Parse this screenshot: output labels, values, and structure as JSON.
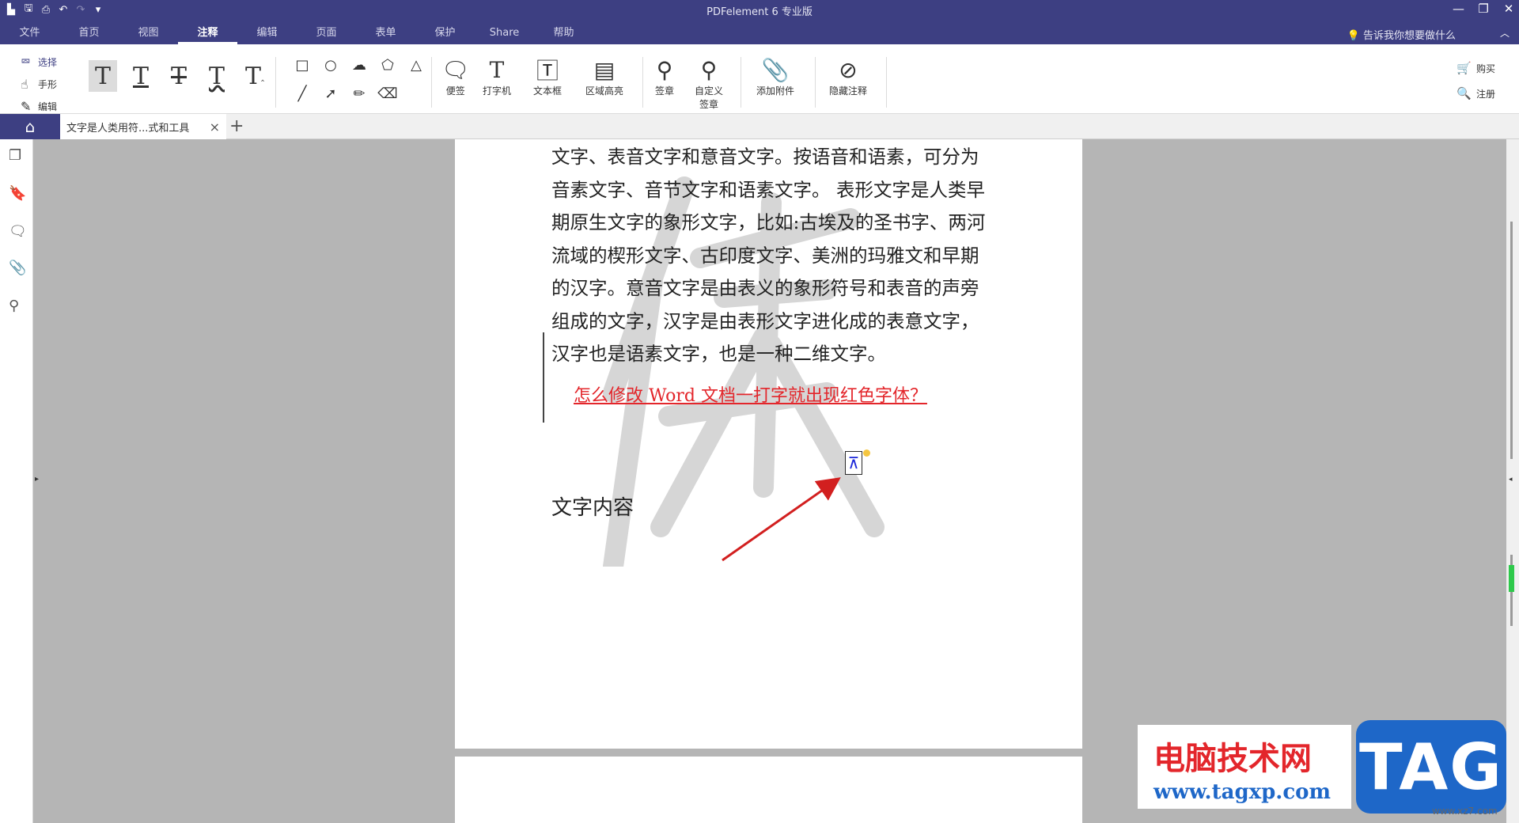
{
  "app": {
    "title": "PDFelement  6 专业版",
    "quick_access": [
      "file-icon",
      "save-icon",
      "print-icon",
      "undo-icon",
      "redo-icon",
      "customize-icon"
    ],
    "window_controls": [
      "—",
      "❐",
      "✕"
    ]
  },
  "menu": {
    "items": [
      "文件",
      "首页",
      "视图",
      "注释",
      "编辑",
      "页面",
      "表单",
      "保护",
      "Share",
      "帮助"
    ],
    "active": "注释",
    "tell_me": "告诉我你想要做什么",
    "collapse": "︿"
  },
  "ribbon": {
    "select": "选择",
    "hand": "手形",
    "edit": "编辑",
    "buttons": {
      "note": "便签",
      "typewriter": "打字机",
      "textbox": "文本框",
      "area_highlight": "区域高亮",
      "stamp": "签章",
      "custom_stamp_l1": "自定义",
      "custom_stamp_l2": "签章",
      "attach": "添加附件",
      "hide_annot": "隐藏注释"
    },
    "buy": "购买",
    "register": "注册"
  },
  "tabs": {
    "doc_title": "文字是人类用符...式和工具",
    "close": "×",
    "add": "+"
  },
  "document": {
    "lines": [
      "文字、表音文字和意音文字。按语音和语素，可分为",
      "音素文字、音节文字和语素文字。 表形文字是人类早",
      "期原生文字的象形文字，比如:古埃及的圣书字、两河",
      "流域的楔形文字、古印度文字、美洲的玛雅文和早期",
      "的汉字。意音文字是由表义的象形符号和表音的声旁",
      "组成的文字，汉字是由表形文字进化成的表意文字，",
      "汉字也是语素文字，也是一种二维文字。"
    ],
    "red_link": "怎么修改 Word 文档一打字就出现红色字体？",
    "heading": "文字内容",
    "pin_glyph": "⊼"
  },
  "brand": {
    "cn": "电脑技术网",
    "url": "www.tagxp.com",
    "tag": "TAG",
    "small": "www.xz7.com"
  },
  "colors": {
    "titlebar": "#3d3f82",
    "red_text": "#e3262b",
    "brand_blue": "#1e67c8"
  }
}
